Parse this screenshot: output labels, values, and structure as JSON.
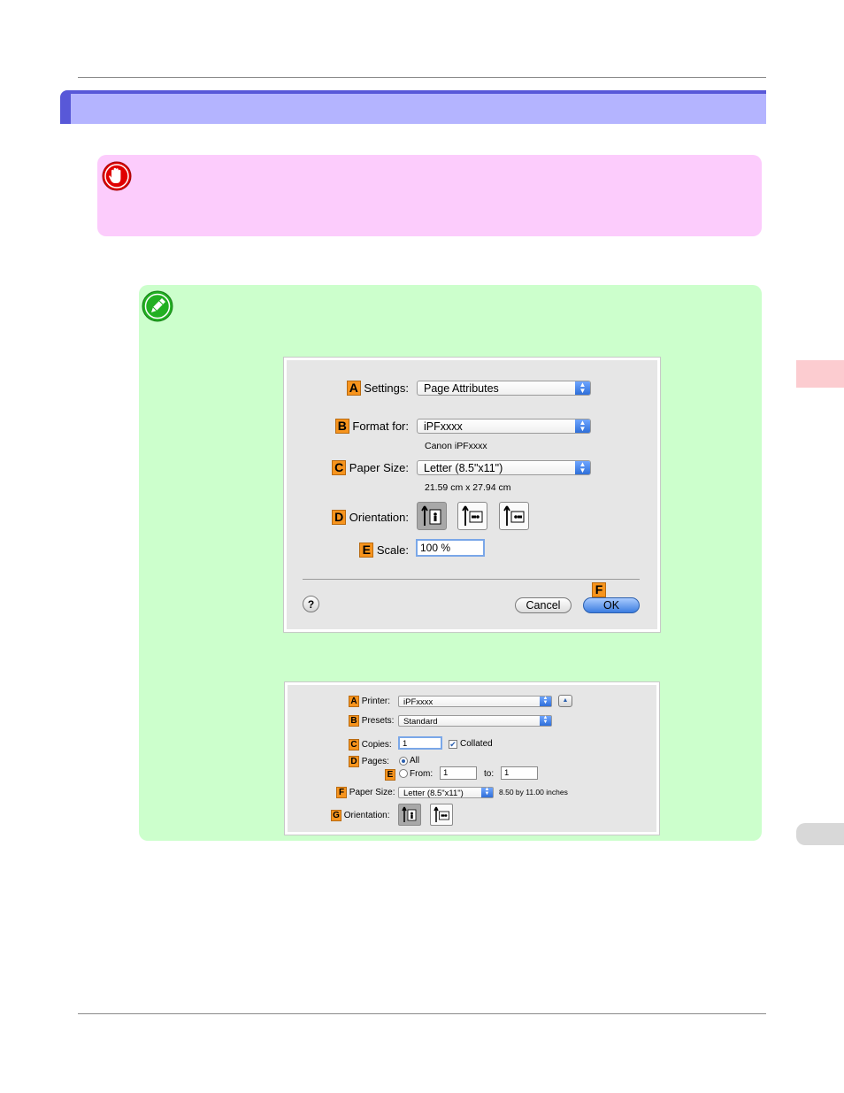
{
  "colors": {
    "section_band": "#5858d8",
    "section_band_light": "#b4b4ff",
    "important_bg": "#fcccfc",
    "note_bg": "#ccffcc",
    "tag_orange": "#f7941d"
  },
  "icons": {
    "important": "stop-hand-icon",
    "note": "pencil-icon"
  },
  "page_setup": {
    "settings": {
      "tag": "A",
      "label": "Settings:",
      "value": "Page Attributes"
    },
    "format_for": {
      "tag": "B",
      "label": "Format for:",
      "value": "iPFxxxx",
      "sub": "Canon iPFxxxx"
    },
    "paper_size": {
      "tag": "C",
      "label": "Paper Size:",
      "value": "Letter (8.5\"x11\")",
      "sub": "21.59 cm x 27.94 cm"
    },
    "orientation": {
      "tag": "D",
      "label": "Orientation:"
    },
    "scale": {
      "tag": "E",
      "label": "Scale:",
      "value": "100 %"
    },
    "ok_tag": "F",
    "help": "?",
    "cancel": "Cancel",
    "ok": "OK"
  },
  "print_dialog": {
    "printer": {
      "tag": "A",
      "label": "Printer:",
      "value": "iPFxxxx"
    },
    "presets": {
      "tag": "B",
      "label": "Presets:",
      "value": "Standard"
    },
    "copies": {
      "tag": "C",
      "label": "Copies:",
      "value": "1",
      "collated": "Collated"
    },
    "pages": {
      "tag": "D",
      "label": "Pages:",
      "all": "All"
    },
    "from": {
      "tag": "E",
      "label": "From:",
      "from_value": "1",
      "to_label": "to:",
      "to_value": "1"
    },
    "paper_size": {
      "tag": "F",
      "label": "Paper Size:",
      "value": "Letter (8.5\"x11\")",
      "sub": "8.50 by 11.00 inches"
    },
    "orientation": {
      "tag": "G",
      "label": "Orientation:"
    }
  }
}
